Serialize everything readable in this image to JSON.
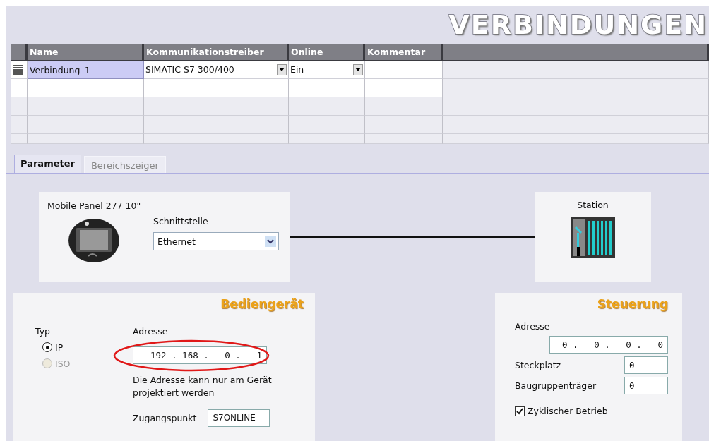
{
  "title": "VERBINDUNGEN",
  "table": {
    "columns": [
      "Name",
      "Kommunikationstreiber",
      "Online",
      "Kommentar"
    ],
    "rows": [
      {
        "name": "Verbindung_1",
        "driver": "SIMATIC S7 300/400",
        "online": "Ein",
        "selected": true
      }
    ]
  },
  "tabs": [
    {
      "label": "Parameter",
      "selected": true
    },
    {
      "label": "Bereichszeiger",
      "selected": false
    }
  ],
  "device": {
    "name": "Mobile Panel 277 10\"",
    "interface_label": "Schnittstelle",
    "interface": "Ethernet"
  },
  "station": {
    "label": "Station"
  },
  "hmi": {
    "title": "Bediengerät",
    "type_label": "Typ",
    "types": [
      {
        "label": "IP",
        "selected": true,
        "disabled": false
      },
      {
        "label": "ISO",
        "selected": false,
        "disabled": true
      }
    ],
    "address_label": "Adresse",
    "address": "192 . 168 .   0 .   1",
    "highlighted": true,
    "note": "Die Adresse kann nur am Gerät projektiert werden",
    "access_label": "Zugangspunkt",
    "access": "S7ONLINE"
  },
  "plc": {
    "title": "Steuerung",
    "address_label": "Adresse",
    "address": "0 .   0 .   0 .   0",
    "slot_label": "Steckplatz",
    "slot": "0",
    "rack_label": "Baugruppenträger",
    "rack": "0",
    "cyclic": {
      "label": "Zyklischer Betrieb",
      "checked": true
    }
  }
}
